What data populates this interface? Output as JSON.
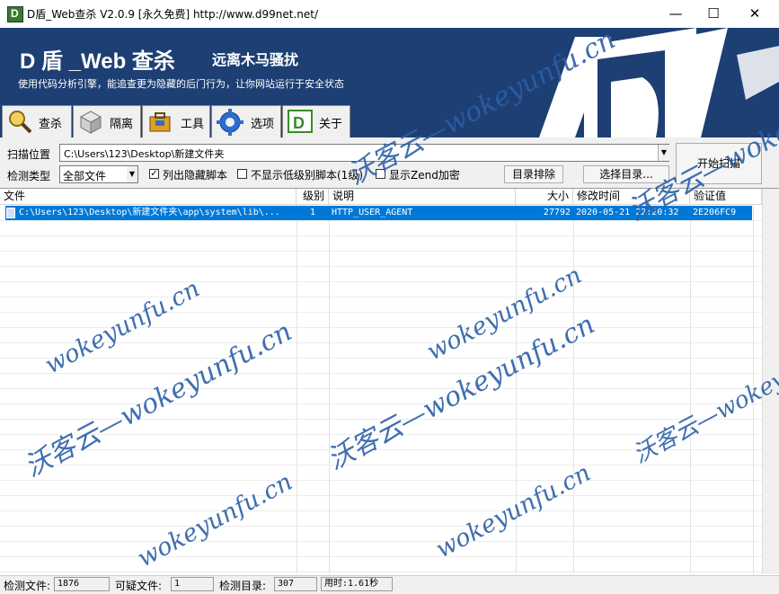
{
  "window": {
    "title": "D盾_Web查杀 V2.0.9 [永久免费] http://www.d99net.net/",
    "minimize": "—",
    "maximize": "☐",
    "close": "✕"
  },
  "banner": {
    "title": "D 盾 _Web 查杀",
    "subtitle": "远离木马骚扰",
    "description": "使用代码分析引擎，能追查更为隐藏的后门行为，让你网站运行于安全状态"
  },
  "tabs": [
    {
      "label": "查杀",
      "icon": "magnifier-icon",
      "color": "#d9a520"
    },
    {
      "label": "隔离",
      "icon": "box-icon",
      "color": "#b0b0b0"
    },
    {
      "label": "工具",
      "icon": "toolbox-icon",
      "color": "#e0a020"
    },
    {
      "label": "选项",
      "icon": "gear-icon",
      "color": "#2a6fd0"
    },
    {
      "label": "关于",
      "icon": "d-logo-icon",
      "color": "#3a8a2a"
    }
  ],
  "scan": {
    "location_label": "扫描位置",
    "location_value": "C:\\Users\\123\\Desktop\\新建文件夹",
    "start_button": "开始扫描"
  },
  "options": {
    "type_label": "检测类型",
    "type_value": "全部文件",
    "show_hidden_label": "列出隐藏脚本",
    "show_hidden_checked": "✓",
    "hide_low_label": "不显示低级别脚本(1级)",
    "zend_label": "显示Zend加密",
    "exclude_dir_button": "目录排除",
    "select_dir_button": "选择目录..."
  },
  "table": {
    "columns": [
      "文件",
      "级别",
      "说明",
      "大小",
      "修改时间",
      "验证值"
    ],
    "rows": [
      {
        "file": "C:\\Users\\123\\Desktop\\新建文件夹\\app\\system\\lib\\...",
        "level": "1",
        "desc": "HTTP_USER_AGENT",
        "size": "27792",
        "mtime": "2020-05-21 22:20:32",
        "hash": "2E206FC9"
      }
    ]
  },
  "status": {
    "files_label": "检测文件:",
    "files_value": "1876",
    "suspicious_label": "可疑文件:",
    "suspicious_value": "1",
    "dirs_label": "检测目录:",
    "dirs_value": "307",
    "time_label": "用时:1.61秒"
  },
  "watermark": {
    "domain": "wokeyunfu.cn",
    "brand": "沃客云—wokeyunfu.cn"
  }
}
